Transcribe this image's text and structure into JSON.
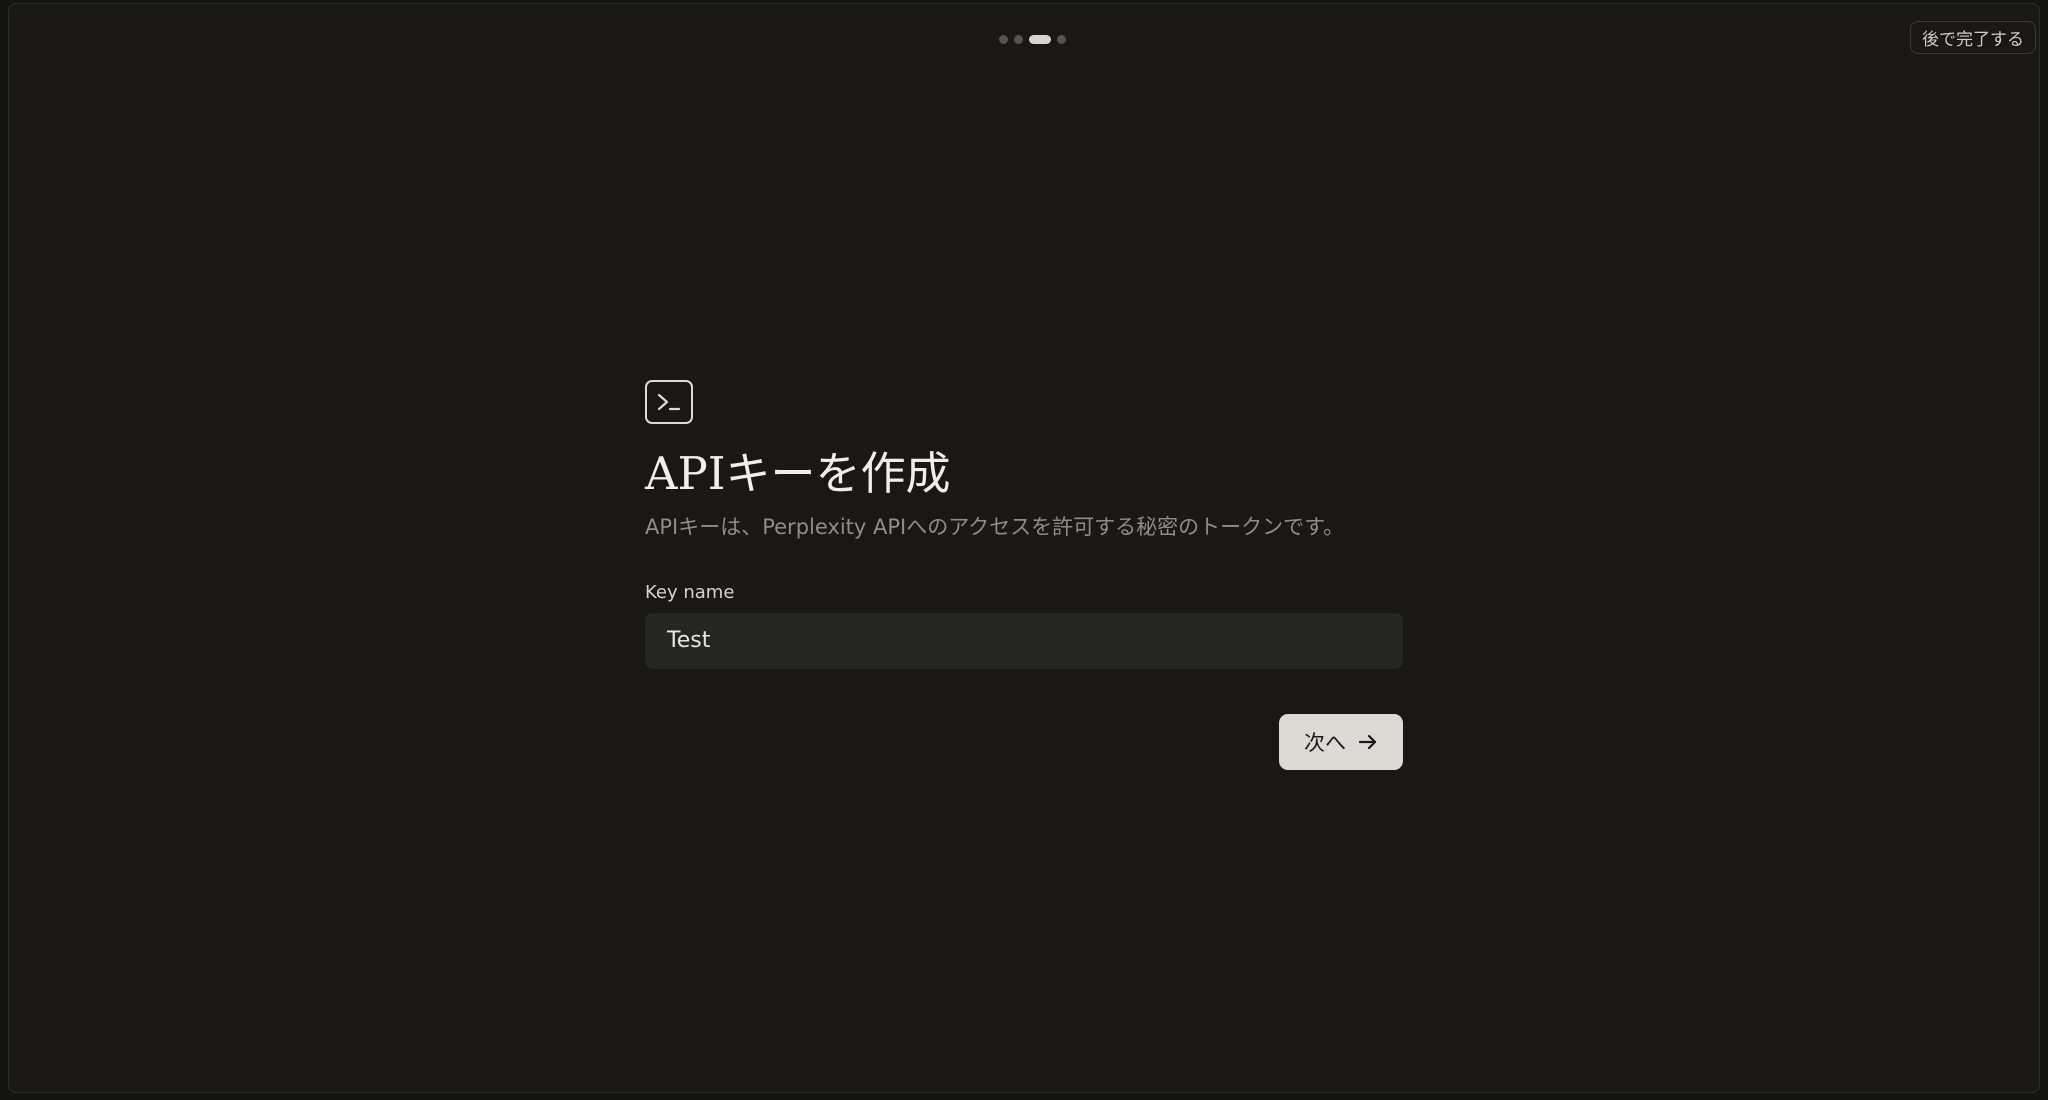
{
  "header": {
    "skip_label": "後で完了する",
    "steps": {
      "total": 4,
      "current": 3
    }
  },
  "main": {
    "icon": "terminal-icon",
    "title": "APIキーを作成",
    "subtitle": "APIキーは、Perplexity APIへのアクセスを許可する秘密のトークンです。",
    "key_name_label": "Key name",
    "key_name_value": "Test",
    "next_label": "次へ",
    "next_icon": "arrow-right-icon"
  },
  "colors": {
    "background": "#191817",
    "primary_button": "#dcdad5",
    "input_background": "#252524",
    "muted_text": "#8f8d88"
  }
}
